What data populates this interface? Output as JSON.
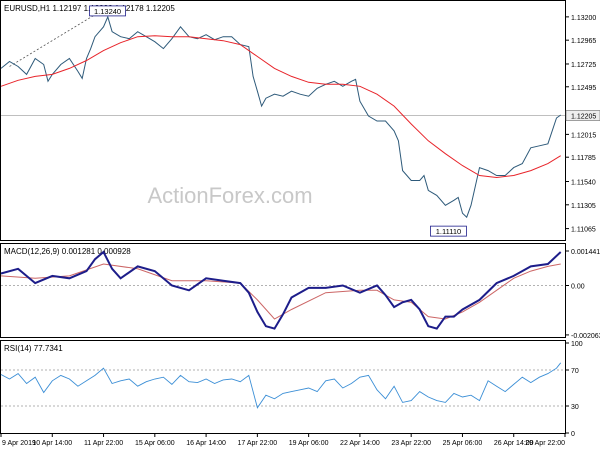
{
  "colors": {
    "price": "#2e5a7a",
    "ma": "#e8242a",
    "macd": "#1d1d8a",
    "signal": "#cc6666",
    "rsi": "#3c8fd6",
    "grid": "#999999",
    "current_box": "#eeeeee"
  },
  "chart_data": [
    {
      "type": "line",
      "title": "EURUSD,H1  1.12197 1.12232 1.12178 1.12205",
      "watermark": "ActionForex.com",
      "ylim": [
        1.1095,
        1.1335
      ],
      "y_ticks": [
        "1.13200",
        "1.12965",
        "1.12725",
        "1.12495",
        "1.12205",
        "1.12015",
        "1.11785",
        "1.11540",
        "1.11305",
        "1.11065"
      ],
      "y_tick_values": [
        1.132,
        1.12965,
        1.12725,
        1.12495,
        1.12205,
        1.12015,
        1.11785,
        1.1154,
        1.11305,
        1.11065
      ],
      "current_price": "1.12205",
      "current_price_value": 1.12205,
      "annotations": [
        {
          "text": "1.13240",
          "x": 24,
          "y": 1.1324
        },
        {
          "text": "1.11110",
          "x": 108,
          "y": 1.1111
        }
      ],
      "trend_line": [
        {
          "x": 2,
          "y": 1.127
        },
        {
          "x": 25,
          "y": 1.133
        }
      ],
      "series": [
        {
          "name": "price",
          "x": [
            0,
            2,
            4,
            6,
            8,
            10,
            11,
            12,
            14,
            16,
            18,
            19,
            20,
            21,
            22,
            24,
            25,
            26,
            28,
            30,
            32,
            34,
            36,
            38,
            40,
            42,
            44,
            46,
            48,
            50,
            52,
            54,
            56,
            58,
            59,
            60,
            61,
            62,
            64,
            66,
            68,
            70,
            72,
            74,
            76,
            78,
            80,
            82,
            83,
            84,
            86,
            88,
            90,
            92,
            93,
            94,
            95,
            96,
            98,
            99,
            100,
            102,
            104,
            106,
            107,
            108,
            109,
            110,
            112,
            114,
            116,
            118,
            120,
            122,
            124,
            126,
            128,
            130,
            131
          ],
          "values": [
            1.1268,
            1.1275,
            1.127,
            1.1262,
            1.1278,
            1.1272,
            1.1255,
            1.1262,
            1.1272,
            1.1278,
            1.1265,
            1.1258,
            1.1278,
            1.1288,
            1.13,
            1.131,
            1.132,
            1.1305,
            1.13,
            1.1298,
            1.1305,
            1.13,
            1.1295,
            1.1288,
            1.1298,
            1.131,
            1.13,
            1.1298,
            1.1302,
            1.1297,
            1.13,
            1.13,
            1.1292,
            1.129,
            1.126,
            1.1245,
            1.123,
            1.1238,
            1.1242,
            1.124,
            1.1245,
            1.1242,
            1.124,
            1.1248,
            1.1252,
            1.1255,
            1.125,
            1.1255,
            1.1257,
            1.1235,
            1.122,
            1.1215,
            1.1215,
            1.1205,
            1.1195,
            1.1165,
            1.116,
            1.1155,
            1.1155,
            1.116,
            1.1145,
            1.114,
            1.113,
            1.1135,
            1.1138,
            1.1122,
            1.1118,
            1.113,
            1.1168,
            1.1165,
            1.116,
            1.116,
            1.1168,
            1.1172,
            1.1188,
            1.119,
            1.1192,
            1.1218,
            1.1221
          ]
        },
        {
          "name": "ma",
          "x": [
            0,
            4,
            8,
            12,
            16,
            20,
            24,
            28,
            32,
            36,
            40,
            44,
            48,
            52,
            56,
            60,
            64,
            68,
            72,
            76,
            80,
            84,
            88,
            92,
            96,
            100,
            104,
            108,
            112,
            116,
            120,
            124,
            128,
            131
          ],
          "values": [
            1.125,
            1.1256,
            1.126,
            1.1262,
            1.1268,
            1.1276,
            1.1286,
            1.1294,
            1.13,
            1.1301,
            1.13,
            1.13,
            1.1298,
            1.1296,
            1.1292,
            1.128,
            1.1268,
            1.126,
            1.1254,
            1.1252,
            1.1252,
            1.125,
            1.1242,
            1.123,
            1.1212,
            1.1195,
            1.1182,
            1.117,
            1.116,
            1.1158,
            1.116,
            1.1165,
            1.1172,
            1.118
          ]
        }
      ]
    },
    {
      "type": "line",
      "title": "MACD(12,26,9) 0.001281 0.000928",
      "ylim": [
        -0.00215,
        0.00165
      ],
      "y_ticks": [
        "0.001441",
        "0.00",
        "-0.002063"
      ],
      "y_tick_values": [
        0.001441,
        0.0,
        -0.002063
      ],
      "series": [
        {
          "name": "macd",
          "x": [
            0,
            4,
            8,
            12,
            16,
            20,
            22,
            24,
            26,
            28,
            32,
            36,
            40,
            44,
            48,
            52,
            56,
            58,
            60,
            62,
            64,
            66,
            68,
            72,
            76,
            80,
            84,
            88,
            90,
            92,
            94,
            96,
            98,
            100,
            102,
            104,
            106,
            108,
            112,
            116,
            120,
            124,
            128,
            131
          ],
          "values": [
            0.0005,
            0.0007,
            0.0001,
            0.0004,
            0.0003,
            0.0006,
            0.0011,
            0.0014,
            0.0007,
            0.0003,
            0.0008,
            0.0006,
            0.0,
            -0.0002,
            0.0003,
            0.0002,
            0.0001,
            -0.0003,
            -0.0011,
            -0.0017,
            -0.0018,
            -0.0012,
            -0.0005,
            -0.0001,
            -0.0001,
            0.0,
            -0.0003,
            0.0,
            -0.0004,
            -0.0009,
            -0.0007,
            -0.0006,
            -0.001,
            -0.0017,
            -0.0018,
            -0.0013,
            -0.0013,
            -0.001,
            -0.0006,
            0.0001,
            0.0004,
            0.0008,
            0.0009,
            0.0014
          ]
        },
        {
          "name": "signal",
          "x": [
            0,
            8,
            16,
            24,
            32,
            40,
            48,
            56,
            60,
            64,
            68,
            76,
            84,
            88,
            92,
            96,
            100,
            104,
            108,
            112,
            116,
            120,
            124,
            128,
            131
          ],
          "values": [
            0.0004,
            0.0003,
            0.0004,
            0.0009,
            0.0007,
            0.0002,
            0.0002,
            0.0001,
            -0.0006,
            -0.0014,
            -0.001,
            -0.0003,
            -0.0002,
            -0.0002,
            -0.0006,
            -0.0007,
            -0.0013,
            -0.0014,
            -0.0011,
            -0.0007,
            -0.0002,
            0.0003,
            0.0006,
            0.0008,
            0.0009
          ]
        }
      ]
    },
    {
      "type": "line",
      "title": "RSI(14) 77.7341",
      "ylim": [
        0,
        100
      ],
      "y_ticks": [
        "100",
        "70",
        "30",
        "0"
      ],
      "y_tick_values": [
        100,
        70,
        30,
        0
      ],
      "x_ticks": [
        "9 Apr 2019",
        "10 Apr 14:00",
        "11 Apr 22:00",
        "15 Apr 06:00",
        "16 Apr 14:00",
        "17 Apr 22:00",
        "19 Apr 06:00",
        "22 Apr 14:00",
        "23 Apr 22:00",
        "25 Apr 06:00",
        "26 Apr 14:00",
        "29 Apr 22:00"
      ],
      "x_tick_positions": [
        0,
        12,
        24,
        36,
        48,
        60,
        72,
        84,
        96,
        108,
        120,
        132
      ],
      "series": [
        {
          "name": "rsi",
          "x": [
            0,
            2,
            4,
            6,
            8,
            10,
            12,
            14,
            16,
            18,
            20,
            22,
            24,
            26,
            28,
            30,
            32,
            34,
            36,
            38,
            40,
            42,
            44,
            46,
            48,
            50,
            52,
            54,
            56,
            58,
            60,
            62,
            64,
            66,
            68,
            70,
            72,
            74,
            76,
            78,
            80,
            82,
            84,
            86,
            88,
            90,
            92,
            94,
            96,
            98,
            100,
            102,
            104,
            106,
            108,
            110,
            112,
            114,
            116,
            118,
            120,
            122,
            124,
            126,
            128,
            130,
            131
          ],
          "values": [
            65,
            60,
            66,
            55,
            62,
            45,
            58,
            64,
            60,
            52,
            58,
            64,
            72,
            55,
            58,
            60,
            52,
            57,
            60,
            62,
            54,
            64,
            57,
            56,
            60,
            55,
            59,
            60,
            57,
            64,
            28,
            42,
            38,
            44,
            46,
            48,
            50,
            46,
            58,
            60,
            50,
            55,
            62,
            64,
            48,
            38,
            52,
            34,
            36,
            46,
            40,
            36,
            34,
            44,
            40,
            42,
            36,
            58,
            52,
            46,
            54,
            62,
            56,
            62,
            66,
            72,
            78
          ]
        }
      ]
    }
  ]
}
